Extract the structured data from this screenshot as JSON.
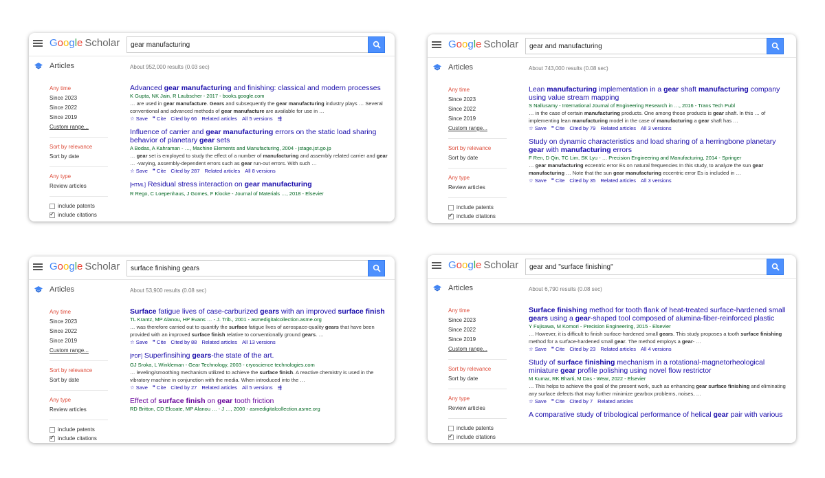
{
  "panels": [
    {
      "query": "gear manufacturing",
      "tab_label": "Articles",
      "results_count": "About 952,000 results (0.03 sec)",
      "sidebar": {
        "time": [
          "Any time",
          "Since 2023",
          "Since 2022",
          "Since 2019",
          "Custom range..."
        ],
        "sort": [
          "Sort by relevance",
          "Sort by date"
        ],
        "type": [
          "Any type",
          "Review articles"
        ],
        "checks": [
          "include patents",
          "include citations"
        ]
      },
      "results": [
        {
          "tag": "",
          "title_parts": [
            [
              "Advanced ",
              false
            ],
            [
              "gear manufacturing",
              true
            ],
            [
              " and finishing: classical and modern processes",
              false
            ]
          ],
          "meta": "K Gupta, NK Jain, R Laubscher - 2017 - books.google.com",
          "snippet_parts": [
            [
              "… are used in ",
              false
            ],
            [
              "gear manufacture",
              true
            ],
            [
              ". ",
              false
            ],
            [
              "Gears",
              true
            ],
            [
              " and subsequently the ",
              false
            ],
            [
              "gear manufacturing",
              true
            ],
            [
              " industry plays … Several conventional and advanced methods of ",
              false
            ],
            [
              "gear manufacture",
              true
            ],
            [
              " are available for use in …",
              false
            ]
          ],
          "actions": [
            "☆ Save",
            "❞ Cite",
            "Cited by 66",
            "Related articles",
            "All 5 versions",
            "⇶"
          ]
        },
        {
          "tag": "",
          "title_parts": [
            [
              "Influence of carrier and ",
              false
            ],
            [
              "gear manufacturing",
              true
            ],
            [
              " errors on the static load sharing behavior of planetary ",
              false
            ],
            [
              "gear",
              true
            ],
            [
              " sets",
              false
            ]
          ],
          "meta": "A Bodas, A Kahraman - …, Machine Elements and Manufacturing, 2004 - jstage.jst.go.jp",
          "snippet_parts": [
            [
              "… ",
              false
            ],
            [
              "gear",
              true
            ],
            [
              " set is employed to study the effect of a number of ",
              false
            ],
            [
              "manufacturing",
              true
            ],
            [
              " and assembly related carrier and ",
              false
            ],
            [
              "gear",
              true
            ],
            [
              " … -varying, assembly-dependent errors such as ",
              false
            ],
            [
              "gear",
              true
            ],
            [
              " run-out errors. With such …",
              false
            ]
          ],
          "actions": [
            "☆ Save",
            "❞ Cite",
            "Cited by 287",
            "Related articles",
            "All 8 versions"
          ]
        },
        {
          "tag": "[HTML]",
          "title_parts": [
            [
              "Residual stress interaction on ",
              false
            ],
            [
              "gear manufacturing",
              true
            ]
          ],
          "meta": "R Rego, C Loepenhaus, J Gomes, F Klocke - Journal of Materials …, 2018 - Elsevier",
          "snippet_parts": [],
          "actions": []
        }
      ]
    },
    {
      "query": "gear and manufacturing",
      "tab_label": "Articles",
      "results_count": "About 743,000 results (0.08 sec)",
      "sidebar": {
        "time": [
          "Any time",
          "Since 2023",
          "Since 2022",
          "Since 2019",
          "Custom range..."
        ],
        "sort": [
          "Sort by relevance",
          "Sort by date"
        ],
        "type": [
          "Any type",
          "Review articles"
        ],
        "checks": [
          "include patents",
          "include citations"
        ]
      },
      "results": [
        {
          "tag": "",
          "title_parts": [
            [
              "Lean ",
              false
            ],
            [
              "manufacturing",
              true
            ],
            [
              " implementation in a ",
              false
            ],
            [
              "gear",
              true
            ],
            [
              " shaft ",
              false
            ],
            [
              "manufacturing",
              true
            ],
            [
              " company using value stream mapping",
              false
            ]
          ],
          "meta": "S Nallusamy - International Journal of Engineering Research in …, 2016 - Trans Tech Publ",
          "snippet_parts": [
            [
              "… in the case of certain ",
              false
            ],
            [
              "manufacturing",
              true
            ],
            [
              " products. One among those products is ",
              false
            ],
            [
              "gear",
              true
            ],
            [
              " shaft. In this … of implementing lean ",
              false
            ],
            [
              "manufacturing",
              true
            ],
            [
              " model in the case of ",
              false
            ],
            [
              "manufacturing",
              true
            ],
            [
              " a ",
              false
            ],
            [
              "gear",
              true
            ],
            [
              " shaft has …",
              false
            ]
          ],
          "actions": [
            "☆ Save",
            "❞ Cite",
            "Cited by 79",
            "Related articles",
            "All 3 versions"
          ]
        },
        {
          "tag": "",
          "title_parts": [
            [
              "Study on dynamic characteristics and load sharing of a herringbone planetary ",
              false
            ],
            [
              "gear",
              true
            ],
            [
              " with ",
              false
            ],
            [
              "manufacturing",
              true
            ],
            [
              " errors",
              false
            ]
          ],
          "meta": "F Ren, D Qin, TC Lim, SK Lyu - … Precision Engineering and Manufacturing, 2014 - Springer",
          "snippet_parts": [
            [
              "… ",
              false
            ],
            [
              "gear manufacturing",
              true
            ],
            [
              " eccentric error Es on natural frequencies In this study, to analyze the sun ",
              false
            ],
            [
              "gear manufacturing",
              true
            ],
            [
              " … Note that the sun ",
              false
            ],
            [
              "gear manufacturing",
              true
            ],
            [
              " eccentric error Es is included in …",
              false
            ]
          ],
          "actions": [
            "☆ Save",
            "❞ Cite",
            "Cited by 35",
            "Related articles",
            "All 3 versions"
          ]
        }
      ]
    },
    {
      "query": "surface finishing gears",
      "tab_label": "Articles",
      "results_count": "About 53,900 results (0.08 sec)",
      "sidebar": {
        "time": [
          "Any time",
          "Since 2023",
          "Since 2022",
          "Since 2019",
          "Custom range..."
        ],
        "sort": [
          "Sort by relevance",
          "Sort by date"
        ],
        "type": [
          "Any type",
          "Review articles"
        ],
        "checks": [
          "include patents",
          "include citations"
        ]
      },
      "results": [
        {
          "tag": "",
          "title_parts": [
            [
              "Surface",
              true
            ],
            [
              " fatigue lives of case-carburized ",
              false
            ],
            [
              "gears",
              true
            ],
            [
              " with an improved ",
              false
            ],
            [
              "surface finish",
              true
            ]
          ],
          "meta": "TL Krantz, MP Alanou, HP Evans … - J. Trib., 2001 - asmedigitalcollection.asme.org",
          "snippet_parts": [
            [
              "… was therefore carried out to quantify the ",
              false
            ],
            [
              "surface",
              true
            ],
            [
              " fatigue lives of aerospace-quality ",
              false
            ],
            [
              "gears",
              true
            ],
            [
              " that have been provided with an improved ",
              false
            ],
            [
              "surface finish",
              true
            ],
            [
              " relative to conventionally ground ",
              false
            ],
            [
              "gears",
              true
            ],
            [
              ". …",
              false
            ]
          ],
          "actions": [
            "☆ Save",
            "❞ Cite",
            "Cited by 88",
            "Related articles",
            "All 13 versions"
          ]
        },
        {
          "tag": "[PDF]",
          "title_parts": [
            [
              "Superfinsihing ",
              false
            ],
            [
              "gears",
              true
            ],
            [
              "-the state of the art.",
              false
            ]
          ],
          "meta": "GJ Sroka, L Winkleman - Gear Technology, 2003 - cryoscience technologies.com",
          "snippet_parts": [
            [
              "… leveling/smoothing mechanism utilized to achieve the ",
              false
            ],
            [
              "surface finish",
              true
            ],
            [
              ". A reactive chemistry is used in the vibratory machine in conjunction with the media. When introduced into the …",
              false
            ]
          ],
          "actions": [
            "☆ Save",
            "❞ Cite",
            "Cited by 27",
            "Related articles",
            "All 5 versions",
            "⇶"
          ]
        },
        {
          "tag": "",
          "visited": true,
          "title_parts": [
            [
              "Effect of ",
              false
            ],
            [
              "surface finish",
              true
            ],
            [
              " on ",
              false
            ],
            [
              "gear",
              true
            ],
            [
              " tooth friction",
              false
            ]
          ],
          "meta": "RD Britton, CD Elcoate, MP Alanou … - J …, 2000 - asmedigitalcollection.asme.org",
          "snippet_parts": [],
          "actions": []
        }
      ]
    },
    {
      "query": "gear and \"surface finishing\"",
      "tab_label": "Articles",
      "results_count": "About 6,790 results (0.08 sec)",
      "sidebar": {
        "time": [
          "Any time",
          "Since 2023",
          "Since 2022",
          "Since 2019",
          "Custom range..."
        ],
        "sort": [
          "Sort by relevance",
          "Sort by date"
        ],
        "type": [
          "Any type",
          "Review articles"
        ],
        "checks": [
          "include patents",
          "include citations"
        ]
      },
      "results": [
        {
          "tag": "",
          "title_parts": [
            [
              "Surface finishing",
              true
            ],
            [
              " method for tooth flank of heat-treated surface-hardened small ",
              false
            ],
            [
              "gears",
              true
            ],
            [
              " using a ",
              false
            ],
            [
              "gear",
              true
            ],
            [
              "-shaped tool composed of alumina-fiber-reinforced plastic",
              false
            ]
          ],
          "meta": "Y Fujisawa, M Komori - Precision Engineering, 2015 - Elsevier",
          "snippet_parts": [
            [
              "… However, it is difficult to finish surface-hardened small ",
              false
            ],
            [
              "gears",
              true
            ],
            [
              ". This study proposes a tooth ",
              false
            ],
            [
              "surface finishing",
              true
            ],
            [
              " method for a surface-hardened small ",
              false
            ],
            [
              "gear",
              true
            ],
            [
              ". The method employs a ",
              false
            ],
            [
              "gear",
              true
            ],
            [
              "- …",
              false
            ]
          ],
          "actions": [
            "☆ Save",
            "❞ Cite",
            "Cited by 23",
            "Related articles",
            "All 4 versions"
          ]
        },
        {
          "tag": "",
          "title_parts": [
            [
              "Study of ",
              false
            ],
            [
              "surface finishing",
              true
            ],
            [
              " mechanism in a rotational-magnetorheological miniature ",
              false
            ],
            [
              "gear",
              true
            ],
            [
              " profile polishing using novel flow restrictor",
              false
            ]
          ],
          "meta": "M Kumar, RK Bharti, M Das - Wear, 2022 - Elsevier",
          "snippet_parts": [
            [
              "… This helps to achieve the goal of the present work, such as enhancing ",
              false
            ],
            [
              "gear surface finishing",
              true
            ],
            [
              " and eliminating any surface defects that may further minimize gearbox problems, noises, …",
              false
            ]
          ],
          "actions": [
            "☆ Save",
            "❞ Cite",
            "Cited by 7",
            "Related articles"
          ]
        },
        {
          "tag": "",
          "title_parts": [
            [
              "A comparative study of tribological performance of helical ",
              false
            ],
            [
              "gear",
              true
            ],
            [
              " pair with various",
              false
            ]
          ],
          "meta": "",
          "snippet_parts": [],
          "actions": []
        }
      ]
    }
  ],
  "logo": {
    "g1": "G",
    "o1": "o",
    "o2": "o",
    "g2": "g",
    "l": "l",
    "e": "e",
    "scholar": "Scholar"
  },
  "colors": {
    "search_button": "#4d90fe",
    "link": "#1a0dab",
    "meta": "#006621",
    "filter_red": "#dd4b39"
  }
}
